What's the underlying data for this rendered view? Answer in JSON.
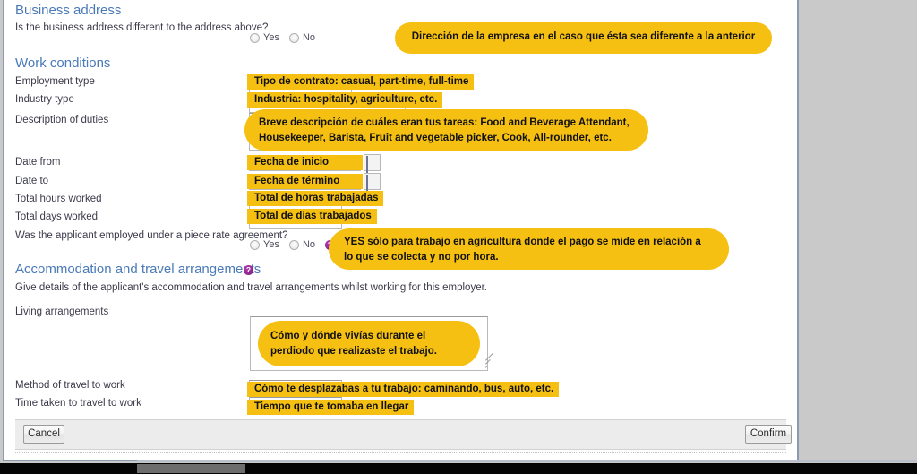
{
  "window": {
    "background_color": "#c9c9c9",
    "panel_background": "#ffffff",
    "panel_border_color": "#8a9ab0",
    "accent_heading_color": "#4a7ab8",
    "highlight_color": "#f6c013",
    "help_icon_color": "#8b1f8b"
  },
  "sections": {
    "business_address": {
      "heading": "Business address",
      "question": "Is the business address different to the address above?",
      "radio_yes": "Yes",
      "radio_no": "No",
      "annotation": "Dirección de la empresa en el caso que ésta sea diferente a la anterior"
    },
    "work_conditions": {
      "heading": "Work conditions",
      "fields": [
        {
          "label": "Employment type",
          "value": "",
          "annotation": "Tipo de contrato: casual, part-time, full-time"
        },
        {
          "label": "Industry type",
          "value": "",
          "annotation": "Industria: hospitality, agriculture, etc."
        },
        {
          "label": "Description of duties",
          "value": "",
          "annotation": "Breve descripción de cuáles eran tus tareas: Food and Beverage Attendant, Housekeeper, Barista, Fruit and vegetable picker, Cook, All-rounder, etc."
        },
        {
          "label": "Date from",
          "value": "",
          "annotation": "Fecha de inicio"
        },
        {
          "label": "Date to",
          "value": "",
          "annotation": "Fecha de término"
        },
        {
          "label": "Total hours worked",
          "value": "",
          "annotation": "Total de horas trabajadas"
        },
        {
          "label": "Total days worked",
          "value": "",
          "annotation": "Total de días trabajados"
        }
      ],
      "duties_annotation_line1": "Breve descripción de cuáles eran tus tareas: Food and Beverage Attendant,",
      "duties_annotation_line2": "Housekeeper, Barista, Fruit and vegetable picker, Cook, All-rounder, etc.",
      "piece_rate_question": "Was the applicant employed under a piece rate agreement?",
      "piece_rate_yes": "Yes",
      "piece_rate_no": "No",
      "piece_rate_help": "?",
      "piece_rate_annotation_line1": "YES sólo para trabajo en agricultura donde el pago se mide en relación a",
      "piece_rate_annotation_line2": "lo que se colecta y no por hora."
    },
    "accommodation": {
      "heading": "Accommodation and travel arrangements",
      "heading_help": "?",
      "description": "Give details of the applicant's accommodation and travel arrangements whilst working for this employer.",
      "living_label": "Living arrangements",
      "living_value": "",
      "living_annotation_line1": "Cómo y dónde vivías durante el",
      "living_annotation_line2": "perdiodo que realizaste el trabajo.",
      "travel_method_label": "Method of travel to work",
      "travel_method_value": "",
      "travel_method_annotation": "Cómo te desplazabas a tu trabajo: caminando, bus, auto, etc.",
      "travel_time_label": "Time taken to travel to work",
      "travel_time_value": "",
      "travel_time_annotation": "Tiempo que te tomaba en llegar"
    }
  },
  "footer": {
    "cancel_label": "Cancel",
    "confirm_label": "Confirm"
  },
  "icons": {
    "calendar_from": "calendar-icon",
    "calendar_to": "calendar-icon"
  }
}
